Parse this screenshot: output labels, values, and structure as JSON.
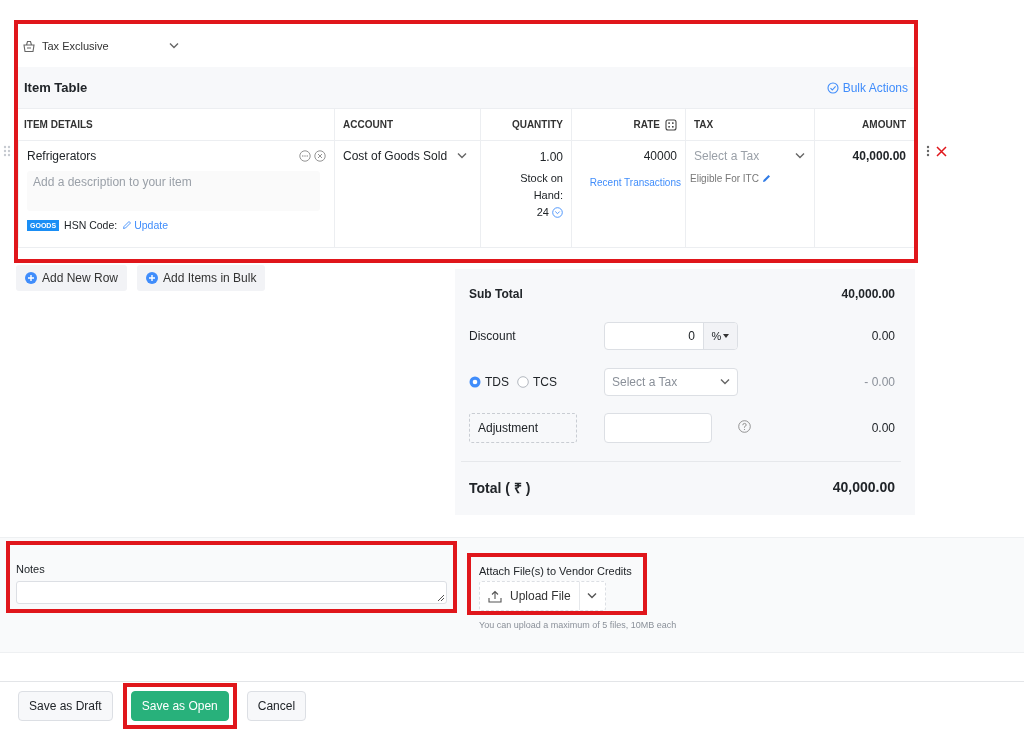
{
  "tax_mode": {
    "label": "Tax Exclusive"
  },
  "item_table": {
    "title": "Item Table",
    "highlighted": true,
    "bulk_actions": "Bulk Actions",
    "columns": [
      "ITEM DETAILS",
      "ACCOUNT",
      "QUANTITY",
      "RATE",
      "TAX",
      "AMOUNT"
    ],
    "rows": [
      {
        "item": "Refrigerators",
        "description_placeholder": "Add a description to your item",
        "type_badge": "GOODS",
        "hsn_label": "HSN Code:",
        "hsn_link": "Update",
        "account": "Cost of Goods Sold",
        "quantity": "1.00",
        "stock_label": "Stock on Hand:",
        "stock": "24",
        "rate": "40000",
        "recent_link": "Recent Transactions",
        "tax_placeholder": "Select a Tax",
        "itc_label": "Eligible For ITC",
        "amount": "40,000.00"
      }
    ]
  },
  "row_actions": [
    "Add New Row",
    "Add Items in Bulk"
  ],
  "totals": {
    "sub_total_label": "Sub Total",
    "sub_total": "40,000.00",
    "discount_label": "Discount",
    "discount_value": "0",
    "discount_unit": "%",
    "discount_amount": "0.00",
    "withholding": [
      {
        "label": "TDS",
        "selected": true
      },
      {
        "label": "TCS",
        "selected": false
      }
    ],
    "withholding_tax_placeholder": "Select a Tax",
    "withholding_amount": "- 0.00",
    "adjustment_label": "Adjustment",
    "adjustment_amount": "0.00",
    "total_label": "Total ( ₹ )",
    "total": "40,000.00"
  },
  "notes": {
    "label": "Notes",
    "highlighted": true
  },
  "attachments": {
    "label": "Attach File(s) to Vendor Credits",
    "button": "Upload File",
    "hint": "You can upload a maximum of 5 files, 10MB each",
    "highlighted": true
  },
  "actions": [
    {
      "label": "Save as Draft",
      "kind": "secondary",
      "highlighted": false
    },
    {
      "label": "Save as Open",
      "kind": "primary",
      "highlighted": true
    },
    {
      "label": "Cancel",
      "kind": "secondary",
      "highlighted": false
    }
  ]
}
